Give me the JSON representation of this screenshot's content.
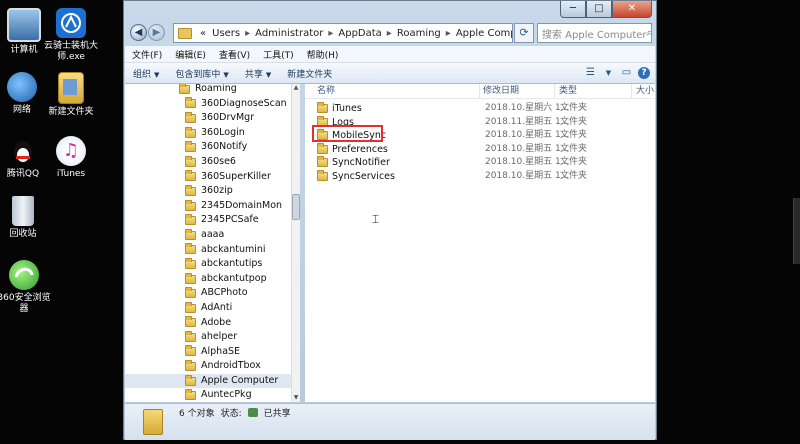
{
  "desktop": {
    "icons": [
      {
        "label": "计算机"
      },
      {
        "label": "云骑士装机大师.exe"
      },
      {
        "label": "网络"
      },
      {
        "label": "新建文件夹"
      },
      {
        "label": "腾讯QQ"
      },
      {
        "label": "iTunes"
      },
      {
        "label": "回收站"
      },
      {
        "label": "360安全浏览器"
      }
    ]
  },
  "window": {
    "controls": {
      "minimize": "─",
      "maximize": "□",
      "close": "✕"
    },
    "address": {
      "prefix": "«",
      "segments": [
        "Users",
        "Administrator",
        "AppData",
        "Roaming",
        "Apple Computer"
      ],
      "separator": "▸"
    },
    "search": {
      "placeholder": "搜索 Apple Computer"
    },
    "menu": [
      "文件(F)",
      "编辑(E)",
      "查看(V)",
      "工具(T)",
      "帮助(H)"
    ],
    "toolbar": {
      "organize": "组织",
      "include_library": "包含到库中",
      "share": "共享",
      "new_folder": "新建文件夹"
    }
  },
  "nav_pane": {
    "items": [
      {
        "label": "Roaming",
        "level": 0,
        "selected": false
      },
      {
        "label": "360DiagnoseScan",
        "level": 1,
        "selected": false
      },
      {
        "label": "360DrvMgr",
        "level": 1,
        "selected": false
      },
      {
        "label": "360Login",
        "level": 1,
        "selected": false
      },
      {
        "label": "360Notify",
        "level": 1,
        "selected": false
      },
      {
        "label": "360se6",
        "level": 1,
        "selected": false
      },
      {
        "label": "360SuperKiller",
        "level": 1,
        "selected": false
      },
      {
        "label": "360zip",
        "level": 1,
        "selected": false
      },
      {
        "label": "2345DomainMon",
        "level": 1,
        "selected": false
      },
      {
        "label": "2345PCSafe",
        "level": 1,
        "selected": false
      },
      {
        "label": "aaaa",
        "level": 1,
        "selected": false
      },
      {
        "label": "abckantumini",
        "level": 1,
        "selected": false
      },
      {
        "label": "abckantutips",
        "level": 1,
        "selected": false
      },
      {
        "label": "abckantutpop",
        "level": 1,
        "selected": false
      },
      {
        "label": "ABCPhoto",
        "level": 1,
        "selected": false
      },
      {
        "label": "AdAnti",
        "level": 1,
        "selected": false
      },
      {
        "label": "Adobe",
        "level": 1,
        "selected": false
      },
      {
        "label": "ahelper",
        "level": 1,
        "selected": false
      },
      {
        "label": "AlphaSE",
        "level": 1,
        "selected": false
      },
      {
        "label": "AndroidTbox",
        "level": 1,
        "selected": false
      },
      {
        "label": "Apple Computer",
        "level": 1,
        "selected": true
      },
      {
        "label": "AuntecPkg",
        "level": 1,
        "selected": false
      }
    ]
  },
  "content": {
    "columns": {
      "name": "名称",
      "date": "修改日期",
      "type": "类型",
      "size": "大小"
    },
    "files": [
      {
        "name": "iTunes",
        "date": "2018.10.星期六 1...",
        "type": "文件夹"
      },
      {
        "name": "Logs",
        "date": "2018.11.星期五 1...",
        "type": "文件夹"
      },
      {
        "name": "MobileSync",
        "date": "2018.10.星期五 1...",
        "type": "文件夹"
      },
      {
        "name": "Preferences",
        "date": "2018.10.星期五 1...",
        "type": "文件夹"
      },
      {
        "name": "SyncNotifier",
        "date": "2018.10.星期五 1...",
        "type": "文件夹"
      },
      {
        "name": "SyncServices",
        "date": "2018.10.星期五 1...",
        "type": "文件夹"
      }
    ]
  },
  "status": {
    "count": "6 个对象",
    "state_label": "状态:",
    "state_value": "已共享"
  },
  "colors": {
    "highlight": "#e03030",
    "folder": "#e8c45a",
    "selected_row": "#dfe7f1"
  }
}
